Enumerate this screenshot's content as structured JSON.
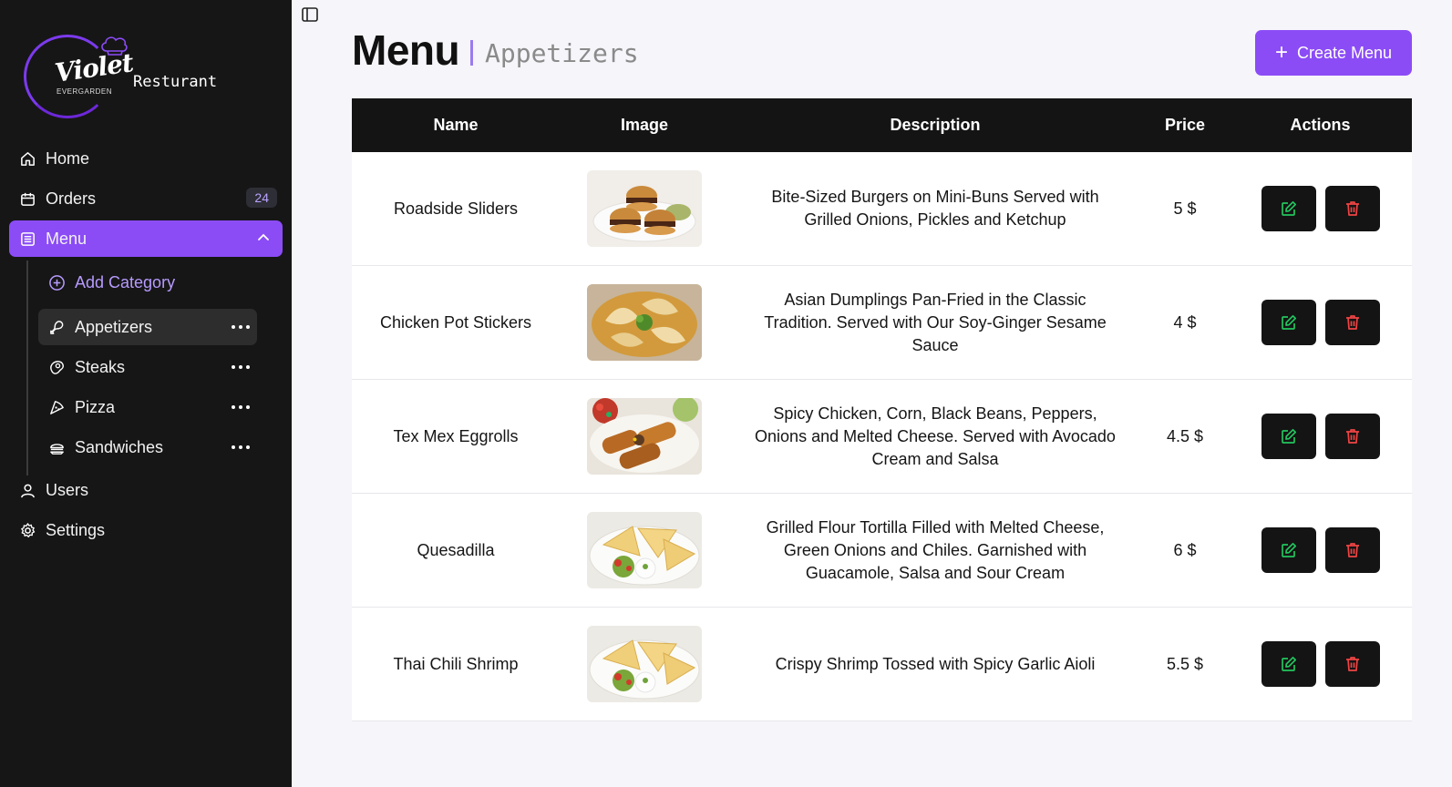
{
  "brand": {
    "logo_script": "Violet",
    "logo_sub": "EVERGARDEN",
    "name": "Resturant"
  },
  "nav": {
    "home": "Home",
    "orders": "Orders",
    "orders_count": "24",
    "menu": "Menu",
    "users": "Users",
    "settings": "Settings"
  },
  "menu_sub": {
    "add_category": "Add Category",
    "categories": [
      "Appetizers",
      "Steaks",
      "Pizza",
      "Sandwiches"
    ]
  },
  "header": {
    "title": "Menu",
    "subtitle": "Appetizers",
    "create_label": "Create Menu"
  },
  "table": {
    "columns": [
      "Name",
      "Image",
      "Description",
      "Price",
      "Actions"
    ],
    "rows": [
      {
        "name": "Roadside Sliders",
        "image": "sliders-photo",
        "description": "Bite-Sized Burgers on Mini-Buns Served with Grilled Onions, Pickles and Ketchup",
        "price": "5 $"
      },
      {
        "name": "Chicken Pot Stickers",
        "image": "potstickers-photo",
        "description": "Asian Dumplings Pan-Fried in the Classic Tradition. Served with Our Soy-Ginger Sesame Sauce",
        "price": "4 $"
      },
      {
        "name": "Tex Mex Eggrolls",
        "image": "eggrolls-photo",
        "description": "Spicy Chicken, Corn, Black Beans, Peppers, Onions and Melted Cheese. Served with Avocado Cream and Salsa",
        "price": "4.5 $"
      },
      {
        "name": "Quesadilla",
        "image": "quesadilla-photo",
        "description": "Grilled Flour Tortilla Filled with Melted Cheese, Green Onions and Chiles. Garnished with Guacamole, Salsa and Sour Cream",
        "price": "6 $"
      },
      {
        "name": "Thai Chili Shrimp",
        "image": "quesadilla-photo",
        "description": "Crispy Shrimp Tossed with Spicy Garlic Aioli",
        "price": "5.5 $"
      }
    ]
  },
  "colors": {
    "accent": "#8b4cf6",
    "sidebar": "#161616",
    "edit": "#22c55e",
    "delete": "#ef4444"
  }
}
